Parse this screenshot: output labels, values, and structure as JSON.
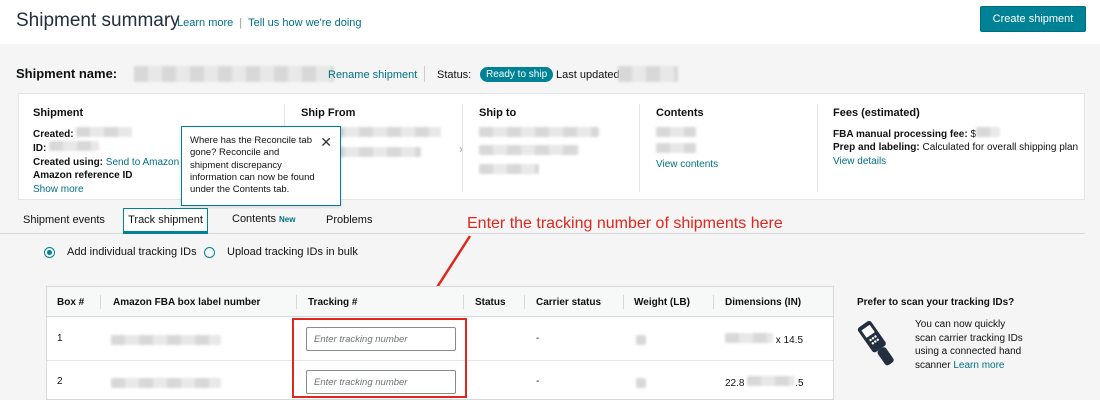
{
  "header": {
    "title": "Shipment summary",
    "learn_more": "Learn more",
    "tell_us": "Tell us how we're doing",
    "create_button": "Create shipment"
  },
  "summary_bar": {
    "name_label": "Shipment name:",
    "rename": "Rename shipment",
    "status_label": "Status:",
    "status_value": "Ready to ship",
    "updated_label": "Last updated:"
  },
  "info": {
    "shipment": {
      "title": "Shipment",
      "created": "Created:",
      "id": "ID:",
      "created_using_label": "Created using:",
      "created_using_value": "Send to Amazon (v",
      "amazon_ref": "Amazon reference ID",
      "show_more": "Show more"
    },
    "ship_from": {
      "title": "Ship From"
    },
    "ship_to": {
      "title": "Ship to"
    },
    "contents": {
      "title": "Contents",
      "view": "View contents"
    },
    "fees": {
      "title": "Fees (estimated)",
      "fba_label": "FBA manual processing fee:",
      "fba_value": "$",
      "prep_label": "Prep and labeling:",
      "prep_value": "Calculated for overall shipping plan",
      "view": "View details"
    }
  },
  "tooltip": {
    "text": "Where has the Reconcile tab gone? Reconcile and shipment discrepancy information can now be found under the Contents tab.",
    "close": "✕"
  },
  "tabs": {
    "events": "Shipment events",
    "track": "Track shipment",
    "contents": "Contents",
    "contents_badge": "New",
    "problems": "Problems"
  },
  "radios": {
    "individual": "Add individual tracking IDs",
    "bulk": "Upload tracking IDs in bulk"
  },
  "annotation": "Enter the tracking number of shipments here",
  "table": {
    "headers": [
      "Box #",
      "Amazon FBA box label number",
      "Tracking #",
      "Status",
      "Carrier status",
      "Weight (LB)",
      "Dimensions (IN)"
    ],
    "rows": [
      {
        "box": "1",
        "placeholder": "Enter tracking number",
        "carrier": "-",
        "dims_prefix": "",
        "dims_suffix": "x 14.5"
      },
      {
        "box": "2",
        "placeholder": "Enter tracking number",
        "carrier": "-",
        "dims_prefix": "22.8",
        "dims_suffix": ".5"
      }
    ]
  },
  "scan": {
    "title": "Prefer to scan your tracking IDs?",
    "text": "You can now quickly scan carrier tracking IDs using a connected hand scanner",
    "learn_more": "Learn more"
  },
  "colors": {
    "accent": "#008296",
    "annotation": "#e0261d"
  }
}
